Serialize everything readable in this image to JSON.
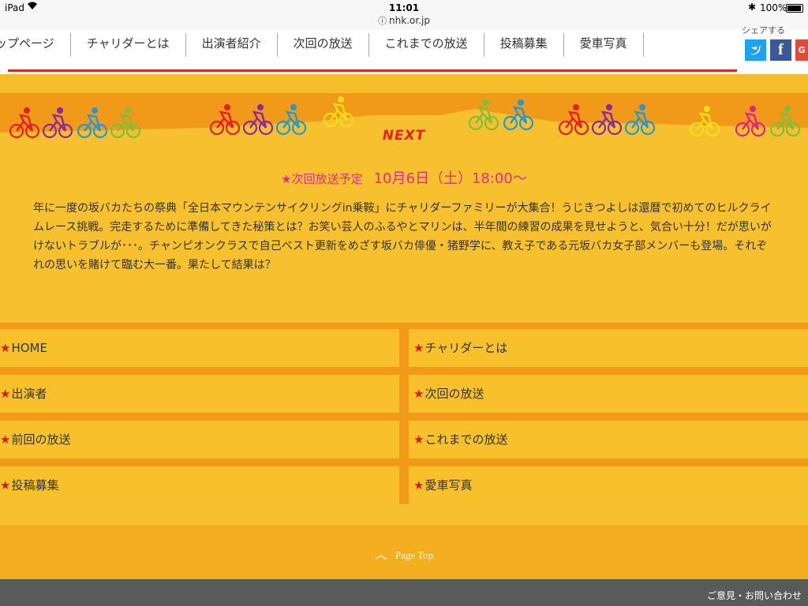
{
  "status_bar": {
    "device": "iPad",
    "time": "11:01",
    "url": "nhk.or.jp",
    "battery": "100%"
  },
  "nav": {
    "items": [
      "ップページ",
      "チャリダーとは",
      "出演者紹介",
      "次回の放送",
      "これまでの放送",
      "投稿募集",
      "愛車写真"
    ],
    "share_label": "シェアする",
    "sns": [
      "twitter-icon",
      "facebook-icon",
      "google-plus-icon"
    ]
  },
  "next": {
    "label": "NEXT",
    "schedule_label": "★次回放送予定",
    "schedule_date": "10月6日（土）18:00～",
    "description": "年に一度の坂バカたちの祭典「全日本マウンテンサイクリングin乗鞍」にチャリダーファミリーが大集合！うじきつよしは還暦で初めてのヒルクライムレース挑戦。完走するために準備してきた秘策とは？お笑い芸人のふるやとマリンは、半年間の練習の成果を見せようと、気合い十分！だが思いがけないトラブルが･･･。チャンピオンクラスで自己ベスト更新をめざす坂バカ俳優・猪野学に、教え子である元坂バカ女子部メンバーも登場。それぞれの思いを賭けて臨む大一番。果たして結果は？"
  },
  "links": {
    "left": [
      "HOME",
      "出演者",
      "前回の放送",
      "投稿募集"
    ],
    "right": [
      "チャリダーとは",
      "次回の放送",
      "これまでの放送",
      "愛車写真"
    ]
  },
  "page_top": "Page Top",
  "footer": {
    "contact": "ご意見・お問い合わせ"
  },
  "colors": {
    "background": "#f7c02e",
    "band": "#f19a1a",
    "accent_red": "#d62a1f",
    "schedule_pink": "#e02d8a"
  }
}
